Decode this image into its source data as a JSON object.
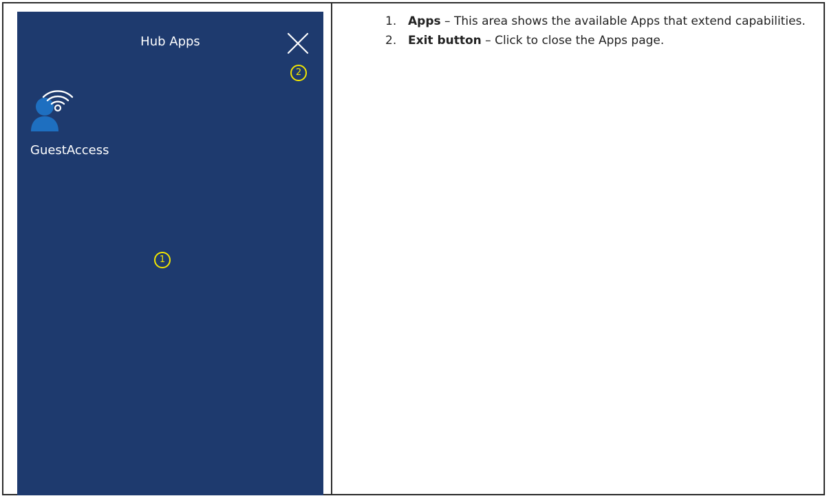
{
  "screen": {
    "title": "Hub Apps",
    "close_icon": "close-x-icon",
    "apps": [
      {
        "label": "GuestAccess",
        "icon": "guest-access-wifi-user-icon"
      }
    ],
    "callouts": [
      "1",
      "2"
    ]
  },
  "description": {
    "items": [
      {
        "number": "1.",
        "term": "Apps",
        "separator": " – ",
        "text": "This area shows the available Apps that extend capabilities."
      },
      {
        "number": "2.",
        "term": "Exit button",
        "separator": " – ",
        "text": "Click to close the Apps page."
      }
    ]
  },
  "colors": {
    "screen_background": "#1e3a6e",
    "callout": "#f2e600",
    "icon_blue": "#1e6fc0",
    "text_dark": "#222222"
  }
}
